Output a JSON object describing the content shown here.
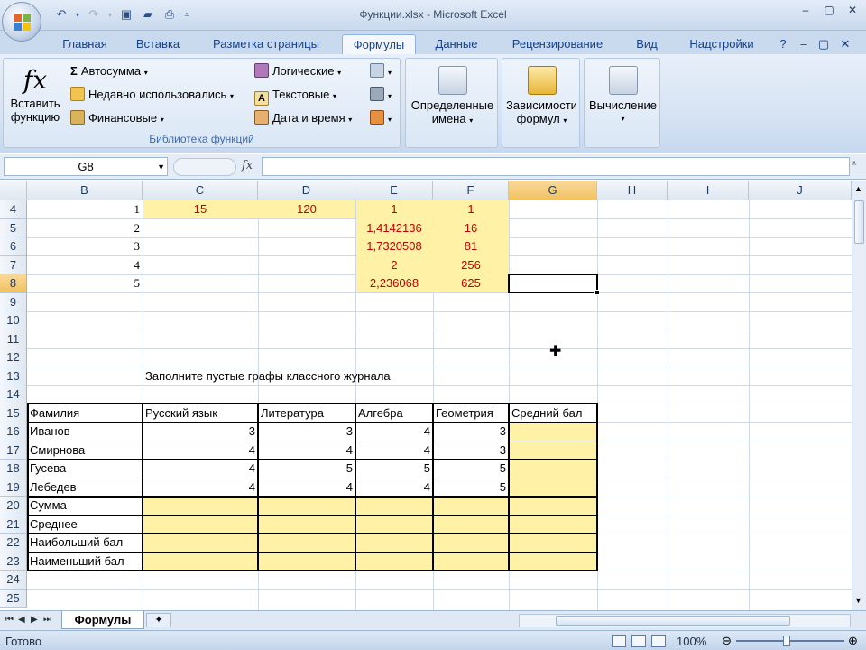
{
  "window": {
    "title": "Функции.xlsx - Microsoft Excel"
  },
  "tabs": [
    "Главная",
    "Вставка",
    "Разметка страницы",
    "Формулы",
    "Данные",
    "Рецензирование",
    "Вид",
    "Надстройки"
  ],
  "active_tab": "Формулы",
  "ribbon": {
    "insert_function": "Вставить функцию",
    "insert_function_l1": "Вставить",
    "insert_function_l2": "функцию",
    "autosum": "Автосумма",
    "recent": "Недавно использовались",
    "financial": "Финансовые",
    "logical": "Логические",
    "text": "Текстовые",
    "datetime": "Дата и время",
    "group_label": "Библиотека функций",
    "defined_names_l1": "Определенные",
    "defined_names_l2": "имена",
    "dependencies_l1": "Зависимости",
    "dependencies_l2": "формул",
    "calculation": "Вычисление"
  },
  "formula_bar": {
    "name_box": "G8",
    "formula": ""
  },
  "columns": [
    "B",
    "C",
    "D",
    "E",
    "F",
    "G",
    "H",
    "I",
    "J"
  ],
  "selected_column": "G",
  "rows": [
    "4",
    "5",
    "6",
    "7",
    "8",
    "9",
    "10",
    "11",
    "12",
    "13",
    "14",
    "15",
    "16",
    "17",
    "18",
    "19",
    "20",
    "21",
    "22",
    "23",
    "24",
    "25"
  ],
  "selected_row": "8",
  "cells": {
    "b": [
      "1",
      "2",
      "3",
      "4",
      "5"
    ],
    "c4": "15",
    "d4": "120",
    "e": [
      "1",
      "1,4142136",
      "1,7320508",
      "2",
      "2,236068"
    ],
    "f": [
      "1",
      "16",
      "81",
      "256",
      "625"
    ],
    "caption": "Заполните пустые графы классного журнала"
  },
  "journal": {
    "headers": [
      "Фамилия",
      "Русский язык",
      "Литература",
      "Алгебра",
      "Геометрия",
      "Средний бал"
    ],
    "students": [
      {
        "name": "Иванов",
        "scores": [
          "3",
          "3",
          "4",
          "3"
        ]
      },
      {
        "name": "Смирнова",
        "scores": [
          "4",
          "4",
          "4",
          "3"
        ]
      },
      {
        "name": "Гусева",
        "scores": [
          "4",
          "5",
          "5",
          "5"
        ]
      },
      {
        "name": "Лебедев",
        "scores": [
          "4",
          "4",
          "4",
          "5"
        ]
      }
    ],
    "summary": [
      "Сумма",
      "Среднее",
      "Наибольший бал",
      "Наименьший бал"
    ]
  },
  "sheet_tab": "Формулы",
  "status": {
    "text": "Готово",
    "zoom": "100%"
  }
}
